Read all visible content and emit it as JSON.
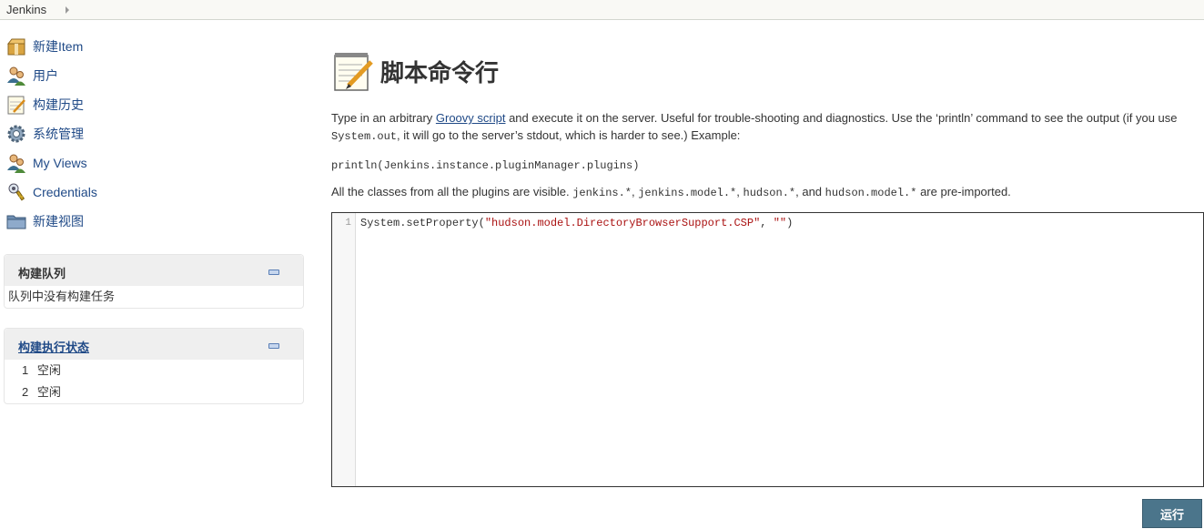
{
  "breadcrumb": {
    "root": "Jenkins"
  },
  "sidebar": {
    "tasks": [
      {
        "label": "新建Item",
        "icon": "new-package-icon"
      },
      {
        "label": "用户",
        "icon": "users-icon"
      },
      {
        "label": "构建历史",
        "icon": "notepad-icon"
      },
      {
        "label": "系统管理",
        "icon": "gear-icon"
      },
      {
        "label": "My Views",
        "icon": "users-icon"
      },
      {
        "label": "Credentials",
        "icon": "credentials-icon"
      },
      {
        "label": "新建视图",
        "icon": "folder-icon"
      }
    ],
    "build_queue": {
      "title": "构建队列",
      "empty_text": "队列中没有构建任务"
    },
    "executors": {
      "title": "构建执行状态",
      "rows": [
        {
          "num": "1",
          "status": "空闲"
        },
        {
          "num": "2",
          "status": "空闲"
        }
      ]
    }
  },
  "main": {
    "title": "脚本命令行",
    "intro_part1": "Type in an arbitrary ",
    "intro_link": "Groovy script",
    "intro_part2": " and execute it on the server. Useful for trouble-shooting and diagnostics. Use the ‘println’ command to see the output (if you use",
    "intro_code": "System.out",
    "intro_part3": ", it will go to the server’s stdout, which is harder to see.) Example:",
    "example_code": "println(Jenkins.instance.pluginManager.plugins)",
    "classes_part1": "All the classes from all the plugins are visible. ",
    "classes_code1": "jenkins.*",
    "sep1": ", ",
    "classes_code2": "jenkins.model.*",
    "sep2": ", ",
    "classes_code3": "hudson.*",
    "sep3": ", and ",
    "classes_code4": "hudson.model.*",
    "classes_part2": " are pre-imported.",
    "editor": {
      "line_number": "1",
      "code_prefix": "System.setProperty(",
      "code_string1": "\"hudson.model.DirectoryBrowserSupport.CSP\"",
      "code_comma": ", ",
      "code_string2": "\"\"",
      "code_suffix": ")"
    },
    "run_button": "运行"
  },
  "colors": {
    "link": "#204a87",
    "run_button": "#4b758b",
    "code_string": "#aa1111"
  }
}
